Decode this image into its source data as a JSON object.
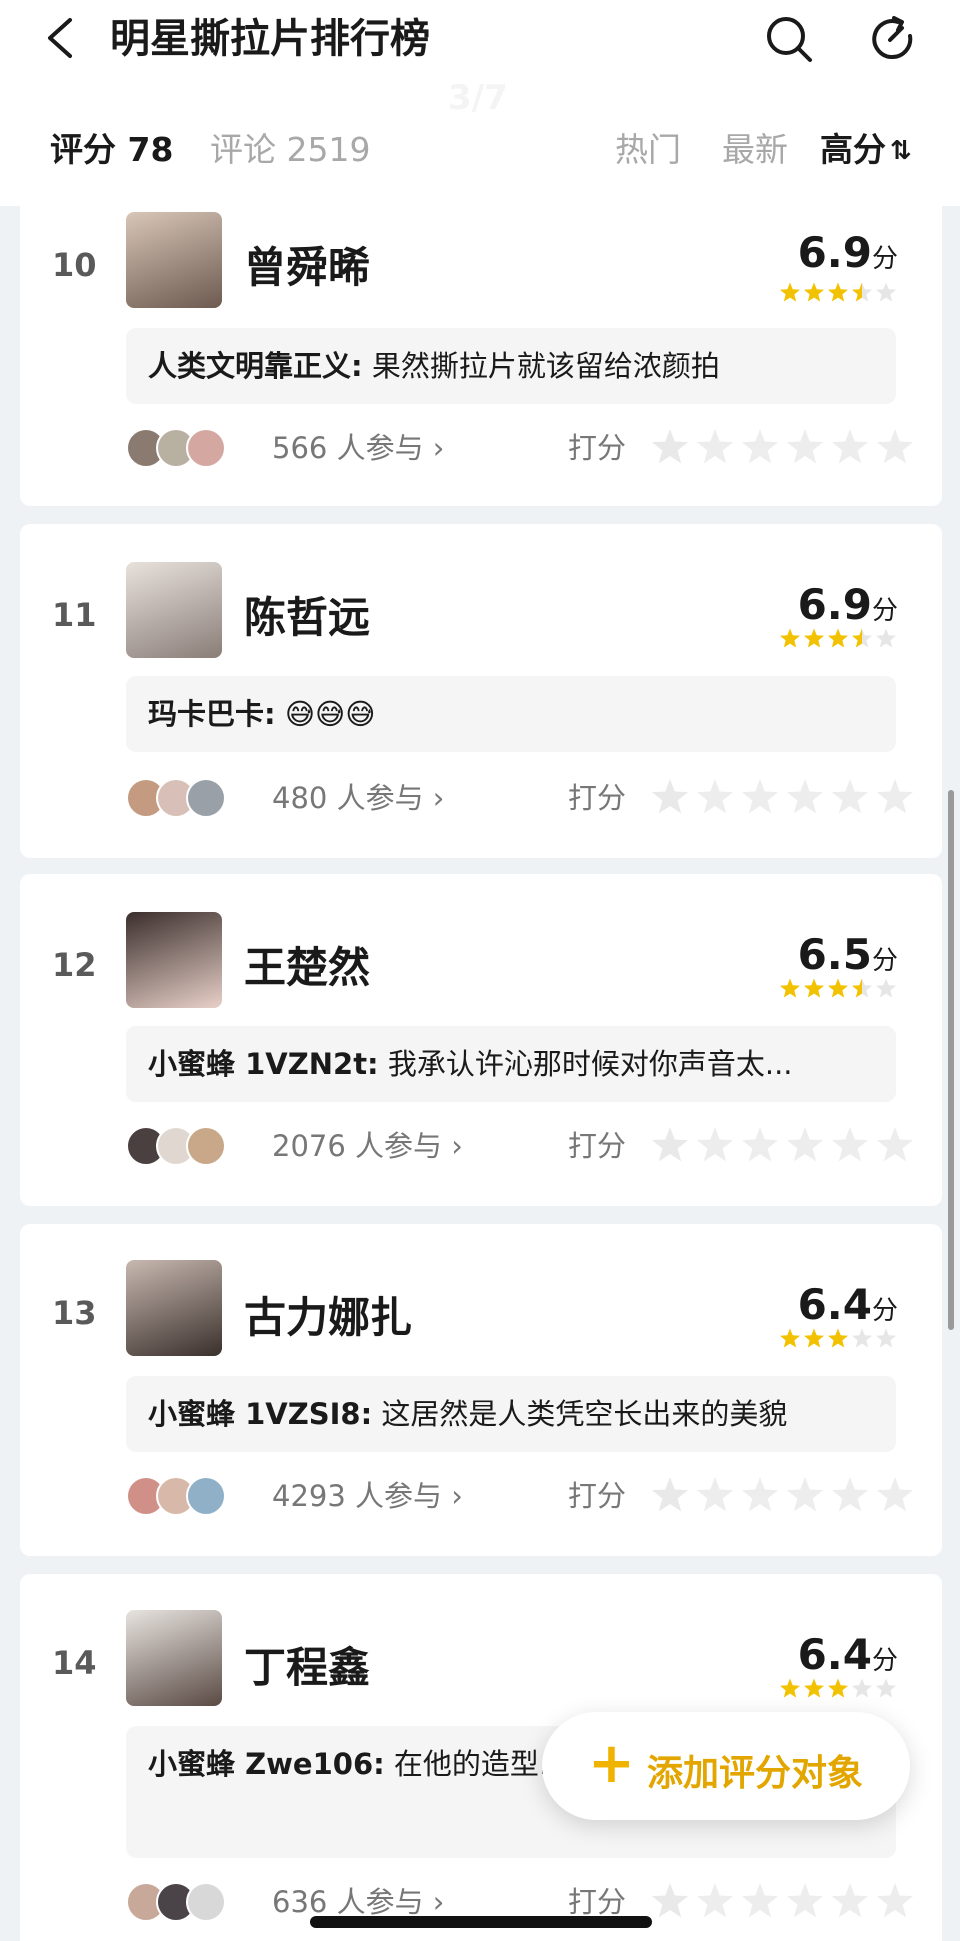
{
  "header": {
    "title": "明星撕拉片排行榜",
    "page_indicator": "3/7"
  },
  "tabs": {
    "score": "评分 78",
    "comments": "评论 2519",
    "sort_hot": "热门",
    "sort_new": "最新",
    "sort_high": "高分",
    "sort_icon": "⇅"
  },
  "colors": {
    "accent": "#f0b400",
    "star_filled": "#f2c200",
    "star_empty": "#e6e6e6"
  },
  "items": [
    {
      "rank": "10",
      "name": "曾舜晞",
      "score": "6.9",
      "unit": "分",
      "stars": 3.5,
      "comment_user": "人类文明靠正义:",
      "comment_text": " 果然撕拉片就该留给浓颜拍",
      "participants": "566 人参与 ›",
      "rate_label": "打分"
    },
    {
      "rank": "11",
      "name": "陈哲远",
      "score": "6.9",
      "unit": "分",
      "stars": 3.5,
      "comment_user": "玛卡巴卡:",
      "comment_text": " 😅😅😅",
      "participants": "480 人参与 ›",
      "rate_label": "打分"
    },
    {
      "rank": "12",
      "name": "王楚然",
      "score": "6.5",
      "unit": "分",
      "stars": 3.5,
      "comment_user": "小蜜蜂 1VZN2t:",
      "comment_text": " 我承认许沁那时候对你声音太...",
      "participants": "2076 人参与 ›",
      "rate_label": "打分"
    },
    {
      "rank": "13",
      "name": "古力娜扎",
      "score": "6.4",
      "unit": "分",
      "stars": 3,
      "comment_user": "小蜜蜂 1VZSI8:",
      "comment_text": " 这居然是人类凭空长出来的美貌",
      "participants": "4293 人参与 ›",
      "rate_label": "打分"
    },
    {
      "rank": "14",
      "name": "丁程鑫",
      "score": "6.4",
      "unit": "分",
      "stars": 3,
      "comment_user": "小蜜蜂 Zwe106:",
      "comment_text": " 在他的造型... 显优点的",
      "participants": "636 人参与 ›",
      "rate_label": "打分"
    }
  ],
  "fab": {
    "plus": "+",
    "label": "添加评分对象"
  }
}
